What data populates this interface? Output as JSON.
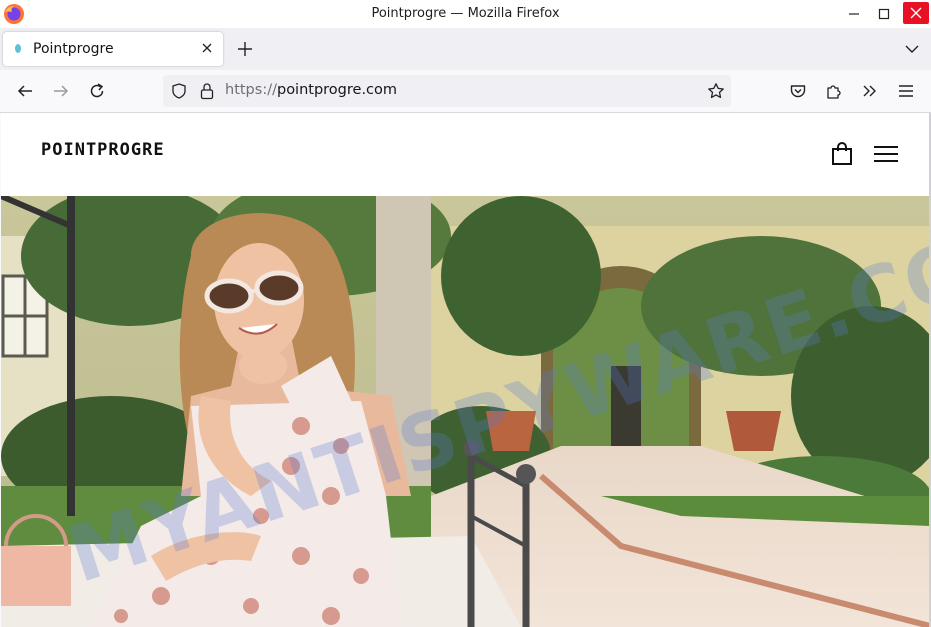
{
  "window": {
    "title": "Pointprogre — Mozilla Firefox"
  },
  "tab": {
    "title": "Pointprogre"
  },
  "url": {
    "protocol": "https://",
    "host": "pointprogre.com"
  },
  "site": {
    "brand": "POINTPROGRE"
  },
  "hero": {
    "watermark": "MYANTISPYWARE.COM"
  },
  "colors": {
    "close_button": "#e81123",
    "tab_bar": "#f0f0f4",
    "brand_text": "#111111"
  }
}
